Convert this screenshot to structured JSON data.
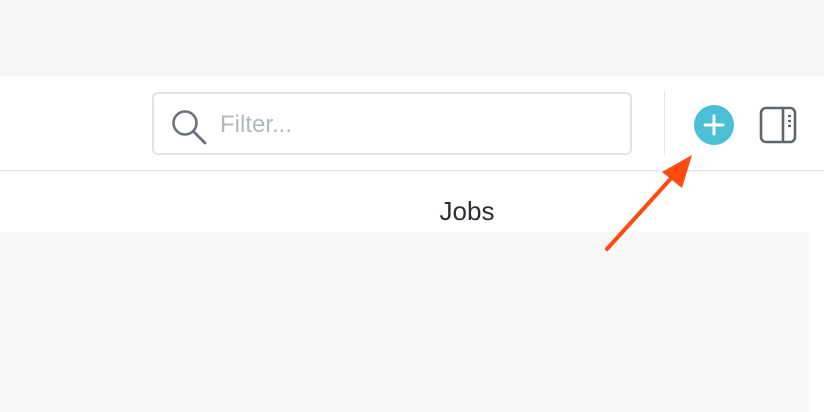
{
  "search": {
    "placeholder": "Filter...",
    "icon": "search-icon"
  },
  "toolbar": {
    "add_icon": "plus-circle-icon",
    "add_color": "#4bbfd6",
    "panel_icon": "sidebar-panel-icon"
  },
  "main": {
    "section_title": "Jobs"
  },
  "annotation": {
    "arrow_color": "#ff4a10"
  }
}
